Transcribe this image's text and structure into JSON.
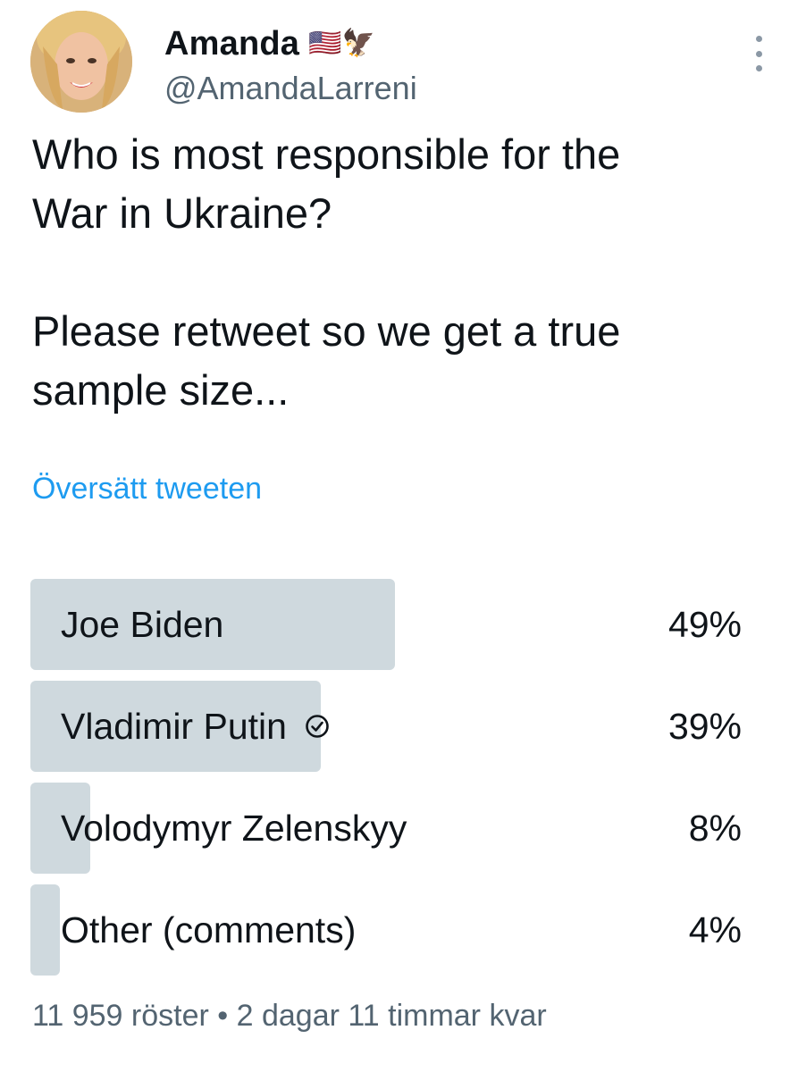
{
  "author": {
    "display_name": "Amanda",
    "name_emojis": "🇺🇸🦅",
    "handle": "@AmandaLarreni",
    "avatar_icon": "profile-photo"
  },
  "tweet": {
    "text": "Who is most responsible for the\nWar in Ukraine?\n\nPlease retweet so we get a true\nsample size...",
    "translate_label": "Översätt tweeten"
  },
  "poll": {
    "options": [
      {
        "label": "Joe Biden",
        "percent_label": "49%",
        "percent": 49,
        "bar_fraction": 0.513,
        "selected": false
      },
      {
        "label": "Vladimir Putin",
        "percent_label": "39%",
        "percent": 39,
        "bar_fraction": 0.408,
        "selected": true
      },
      {
        "label": "Volodymyr Zelenskyy",
        "percent_label": "8%",
        "percent": 8,
        "bar_fraction": 0.084,
        "selected": false
      },
      {
        "label": "Other (comments)",
        "percent_label": "4%",
        "percent": 4,
        "bar_fraction": 0.042,
        "selected": false
      }
    ],
    "footer": "11 959 röster • 2 dagar 11 timmar kvar"
  },
  "colors": {
    "bar": "#cfd9de",
    "link": "#1d9bf0",
    "muted": "#536471",
    "text": "#0f1419"
  }
}
